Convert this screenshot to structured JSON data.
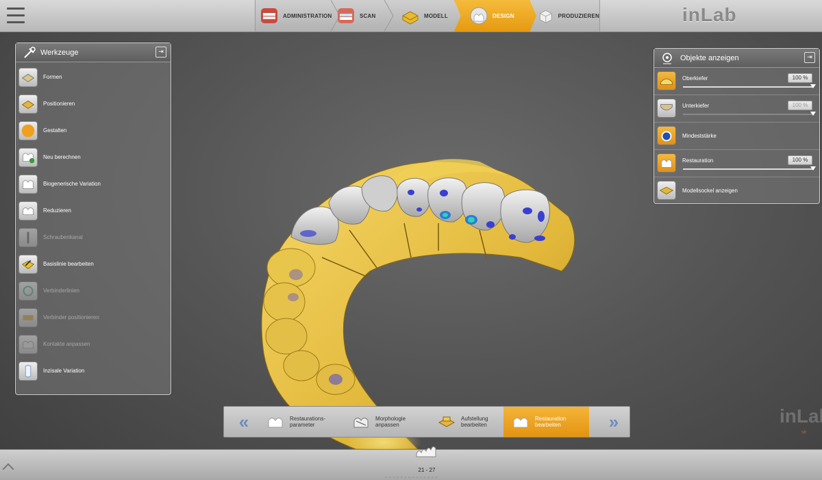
{
  "app": {
    "brand": "inLab",
    "watermark": "inLab",
    "watermark_sub": "sir"
  },
  "phases": [
    {
      "label": "ADMINISTRATION",
      "icon": "teeth-admin-icon"
    },
    {
      "label": "SCAN",
      "icon": "scan-teeth-icon"
    },
    {
      "label": "MODELL",
      "icon": "model-base-icon"
    },
    {
      "label": "DESIGN",
      "icon": "crown-design-icon",
      "active": true
    },
    {
      "label": "PRODUZIEREN",
      "icon": "produce-block-icon"
    }
  ],
  "tools": {
    "title": "Werkzeuge",
    "items": [
      {
        "label": "Formen",
        "enabled": true
      },
      {
        "label": "Positionieren",
        "enabled": true
      },
      {
        "label": "Gestalten",
        "enabled": true
      },
      {
        "label": "Neu berechnen",
        "enabled": true
      },
      {
        "label": "Biogenerische Variation",
        "enabled": true
      },
      {
        "label": "Reduzieren",
        "enabled": true
      },
      {
        "label": "Schraubenkanal",
        "enabled": false
      },
      {
        "label": "Basislinie bearbeiten",
        "enabled": true
      },
      {
        "label": "Verbinderlinien",
        "enabled": false
      },
      {
        "label": "Verbinder positionieren",
        "enabled": false
      },
      {
        "label": "Kontakte anpassen",
        "enabled": false
      },
      {
        "label": "Inzisale Variation",
        "enabled": true
      }
    ]
  },
  "objects": {
    "title": "Objekte anzeigen",
    "items": [
      {
        "label": "Oberkiefer",
        "percent": "100 %",
        "has_slider": true,
        "dim": false
      },
      {
        "label": "Unterkiefer",
        "percent": "100 %",
        "has_slider": true,
        "dim": true
      },
      {
        "label": "Mindeststärke",
        "percent": "",
        "has_slider": false,
        "dim": false
      },
      {
        "label": "Restauration",
        "percent": "100 %",
        "has_slider": true,
        "dim": false
      },
      {
        "label": "Modellsockel anzeigen",
        "percent": "",
        "has_slider": false,
        "dim": false
      }
    ]
  },
  "workflow": {
    "steps": [
      {
        "line1": "Restaurations-",
        "line2": "parameter"
      },
      {
        "line1": "Morphologie",
        "line2": "anpassen"
      },
      {
        "line1": "Aufstellung",
        "line2": "bearbeiten"
      },
      {
        "line1": "Restauration",
        "line2": "bearbeiten",
        "active": true
      }
    ],
    "prev_label": "«",
    "next_label": "»"
  },
  "footer": {
    "range": "21 - 27"
  },
  "colors": {
    "accent": "#eba221",
    "gold": "#e6c04a",
    "crown": "#d8d8d8",
    "thin_spot": "#3a3fd0"
  }
}
